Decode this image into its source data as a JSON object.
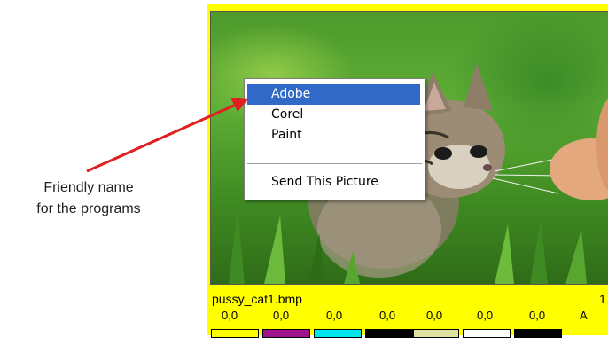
{
  "annotation": {
    "line1": "Friendly name",
    "line2": "for the programs",
    "arrow_color": "#e02020"
  },
  "viewer": {
    "background_color": "#ffff00",
    "filename": "pussy_cat1.bmp",
    "page_number": "1",
    "values": [
      "0,0",
      "0,0",
      "0,0",
      "0,0",
      "0,0",
      "0,0",
      "0,0"
    ],
    "channel_label": "A",
    "swatch_colors": [
      "#ffff00",
      "#a0138e",
      "#00e5ee",
      "#000000",
      "#e0e0a0",
      "#ffffff",
      "#000000"
    ]
  },
  "context_menu": {
    "items": [
      "Adobe",
      "Corel",
      "Paint"
    ],
    "selected_index": 0,
    "send_item": "Send This Picture",
    "highlight_color": "#3169c6"
  }
}
